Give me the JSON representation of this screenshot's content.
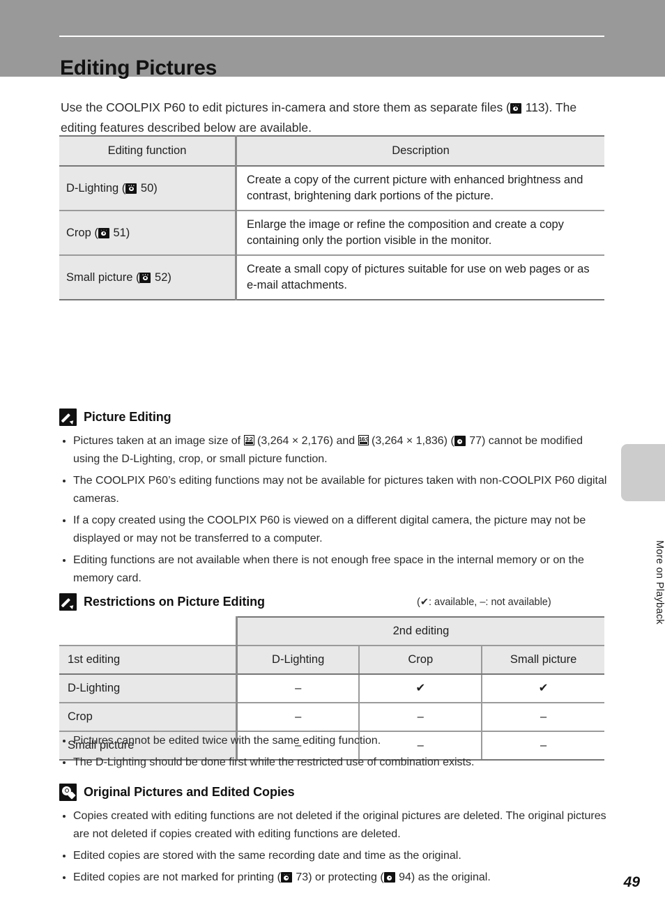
{
  "header": {
    "title": "Editing Pictures"
  },
  "intro": {
    "part1": "Use the COOLPIX P60 to edit pictures in-camera and store them as separate files (",
    "ref_page": "113",
    "part2": "). The editing features described below are available."
  },
  "features_table": {
    "headers": [
      "Editing function",
      "Description"
    ],
    "rows": [
      {
        "function": "D-Lighting (",
        "ref": "50",
        "function_end": ")",
        "description": "Create a copy of the current picture with enhanced brightness and contrast, brightening dark portions of the picture."
      },
      {
        "function": "Crop (",
        "ref": "51",
        "function_end": ")",
        "description": "Enlarge the image or refine the composition and create a copy containing only the portion visible in the monitor."
      },
      {
        "function": "Small picture (",
        "ref": "52",
        "function_end": ")",
        "description": "Create a small copy of pictures suitable for use on web pages or as e-mail attachments."
      }
    ]
  },
  "note_picture_editing": {
    "title": "Picture Editing",
    "bullet1_a": "Pictures taken at an image size of ",
    "bullet1_icon1": "3:2",
    "bullet1_b": " (3,264 × 2,176) and ",
    "bullet1_icon2": "16:9",
    "bullet1_c": " (3,264 × 1,836) (",
    "bullet1_ref": "77",
    "bullet1_d": ") cannot be modified using the D-Lighting, crop, or small picture function.",
    "bullet2": "The COOLPIX P60’s editing functions may not be available for pictures taken with non-COOLPIX P60 digital cameras.",
    "bullet3": "If a copy created using the COOLPIX P60 is viewed on a different digital camera, the picture may not be displayed or may not be transferred to a computer.",
    "bullet4": "Editing functions are not available when there is not enough free space in the internal memory or on the memory card."
  },
  "note_restrictions": {
    "title": "Restrictions on Picture Editing",
    "legend": "(✔: available, –: not available)",
    "table": {
      "spanning_header": "2nd editing",
      "row_header": "1st editing",
      "columns": [
        "D-Lighting",
        "Crop",
        "Small picture"
      ],
      "rows": [
        {
          "label": "D-Lighting",
          "values": [
            "–",
            "✔",
            "✔"
          ]
        },
        {
          "label": "Crop",
          "values": [
            "–",
            "–",
            "–"
          ]
        },
        {
          "label": "Small picture",
          "values": [
            "–",
            "–",
            "–"
          ]
        }
      ]
    },
    "bullet1": "Pictures cannot be edited twice with the same editing function.",
    "bullet2": "The D-Lighting should be done first while the restricted use of combination exists."
  },
  "note_originals": {
    "title": "Original Pictures and Edited Copies",
    "bullet1": "Copies created with editing functions are not deleted if the original pictures are deleted. The original pictures are not deleted if copies created with editing functions are deleted.",
    "bullet2": "Edited copies are stored with the same recording date and time as the original.",
    "bullet3_a": "Edited copies are not marked for printing (",
    "bullet3_ref1": "73",
    "bullet3_b": ") or protecting (",
    "bullet3_ref2": "94",
    "bullet3_c": ") as the original."
  },
  "side_tab": {
    "label": "More on Playback"
  },
  "footer": {
    "page_number": "49"
  }
}
